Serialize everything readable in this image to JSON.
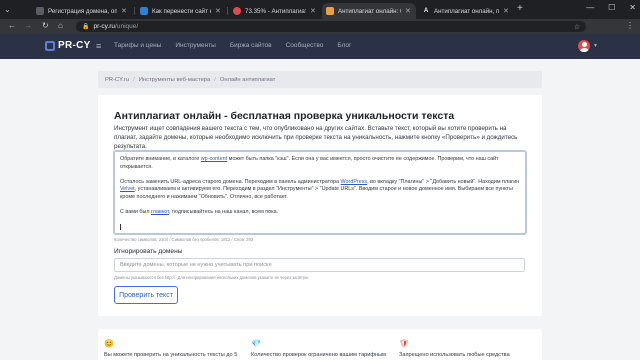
{
  "browser": {
    "tabs": [
      {
        "title": "Регистрация домена, оплата",
        "favicon_color": "#5a5d63",
        "active": false
      },
      {
        "title": "Как перенести сайт на WordPress",
        "favicon_color": "#2f7fd3",
        "active": false
      },
      {
        "title": "73.35% - Антиплагиат онлайн",
        "favicon_color": "#e04b4b",
        "active": false
      },
      {
        "title": "Антиплагиат онлайн: бесп",
        "favicon_color": "#e9a23b",
        "active": true
      },
      {
        "title": "Антиплагиат онлайн, провер",
        "favicon_color": "#eceff3",
        "active": false
      }
    ],
    "url_host": "pr-cy.ru",
    "url_path": "/unique/"
  },
  "site": {
    "logo_text": "PR-CY",
    "nav": [
      "Тарифы и цены",
      "Инструменты",
      "Биржа сайтов",
      "Сообщество",
      "Блог"
    ],
    "accent_color": "#2d63cf",
    "header_bg": "#2b3245"
  },
  "breadcrumb": [
    "PR-CY.ru",
    "Инструменты веб-мастера",
    "Онлайн антиплагиат"
  ],
  "main": {
    "title": "Антиплагиат онлайн - бесплатная проверка уникальности текста",
    "description": "Инструмент ищет совпадения вашего текста с тем, что опубликовано на других сайтах. Вставьте текст, который вы хотите проверить на плагиат, задайте домены, которые необходимо исключить при проверке текста на уникальность, нажмите кнопку «Проверить» и дождитесь результата.",
    "text": {
      "p1_a": "Обратите внимание, в каталоге ",
      "p1_link": "wp-content",
      "p1_b": " может быть папка \"кэш\". Если она у вас имеется, просто очистите ее содержимое. Проверим, что наш сайт открывается.",
      "p2_a": "Осталось заменить URL-адреса старого домена. Переходим в панель администратора ",
      "p2_link1": "WordPress",
      "p2_b": ", во вкладку \"Плагины\" > \"Добавить новый\". Находим плагин ",
      "p2_link2": "Velvet",
      "p2_c": ", устанавливаем и активируем его. Переходим в раздел \"Инструменты\" > \"Update URLs\". Вводим старое и новое доменное имя. Выбираем все пункты кроме последнего и нажимаем \"Обновить\". Отлично, все работает.",
      "p3_a": "С вами был ",
      "p3_link": "главкот",
      "p3_b": ", подписывайтесь на наш канал, всем пока."
    },
    "counts": "Количество символов: 2104 / Символов без пробелов: 1812 / Слов: 293",
    "ignore_label": "Игнорировать домены",
    "ignore_placeholder": "Введите домены, которые не нужно учитывать при поиске",
    "ignore_hint": "Домены указываются без http://. Для игнорирования нескольких доменов укажите их через запятую.",
    "check_button": "Проверить текст"
  },
  "features": [
    {
      "icon": "smile-icon",
      "glyph": "😊",
      "text": "Вы можете проверить на уникальность тексты до 5"
    },
    {
      "icon": "diamond-icon",
      "glyph": "💎",
      "text": "Количество проверок ограничено вашим тарифным"
    },
    {
      "icon": "shield-icon",
      "glyph": "🛡",
      "text": "Запрещено использовать любые средства"
    }
  ]
}
